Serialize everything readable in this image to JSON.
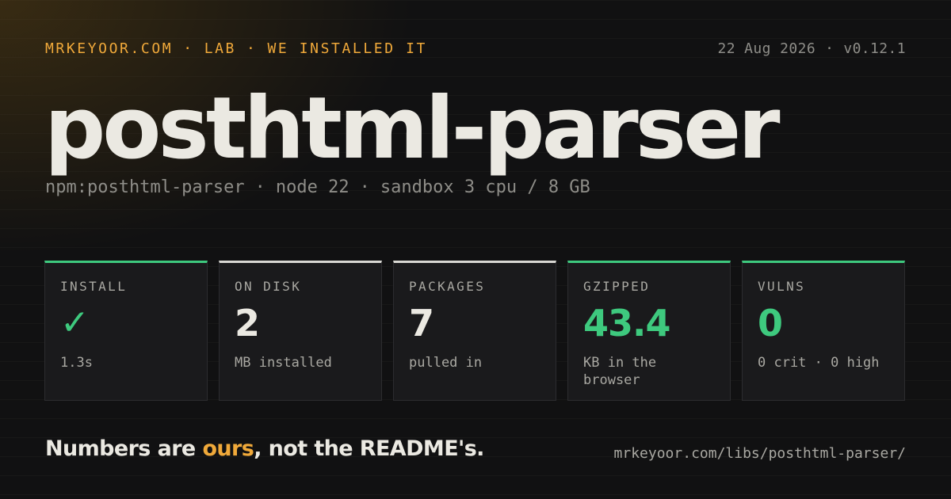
{
  "header": {
    "breadcrumb": [
      "MRKEYOOR.COM",
      "LAB",
      "WE INSTALLED IT"
    ],
    "date": "22 Aug 2026",
    "version": "v0.12.1"
  },
  "title": "posthtml-parser",
  "subtitle": {
    "package": "npm:posthtml-parser",
    "runtime": "node 22",
    "sandbox": "sandbox 3 cpu / 8 GB"
  },
  "cards": [
    {
      "label": "INSTALL",
      "value": "✓",
      "note": "1.3s",
      "status": "good",
      "icon": "checkmark-icon"
    },
    {
      "label": "ON DISK",
      "value": "2",
      "note": "MB installed",
      "status": "neutral"
    },
    {
      "label": "PACKAGES",
      "value": "7",
      "note": "pulled in",
      "status": "neutral"
    },
    {
      "label": "GZIPPED",
      "value": "43.4",
      "note": "KB in the browser",
      "status": "good"
    },
    {
      "label": "VULNS",
      "value": "0",
      "note": "0 crit · 0 high",
      "status": "good"
    }
  ],
  "tagline": {
    "before": "Numbers are ",
    "highlight": "ours",
    "after": ", not the README's."
  },
  "url": "mrkeyoor.com/libs/posthtml-parser/",
  "colors": {
    "accent": "#f0a93a",
    "good": "#3ec97e",
    "neutral": "#d9d8d3",
    "background": "#111112",
    "text": "#ebe9e2",
    "muted": "#8e8d88"
  }
}
